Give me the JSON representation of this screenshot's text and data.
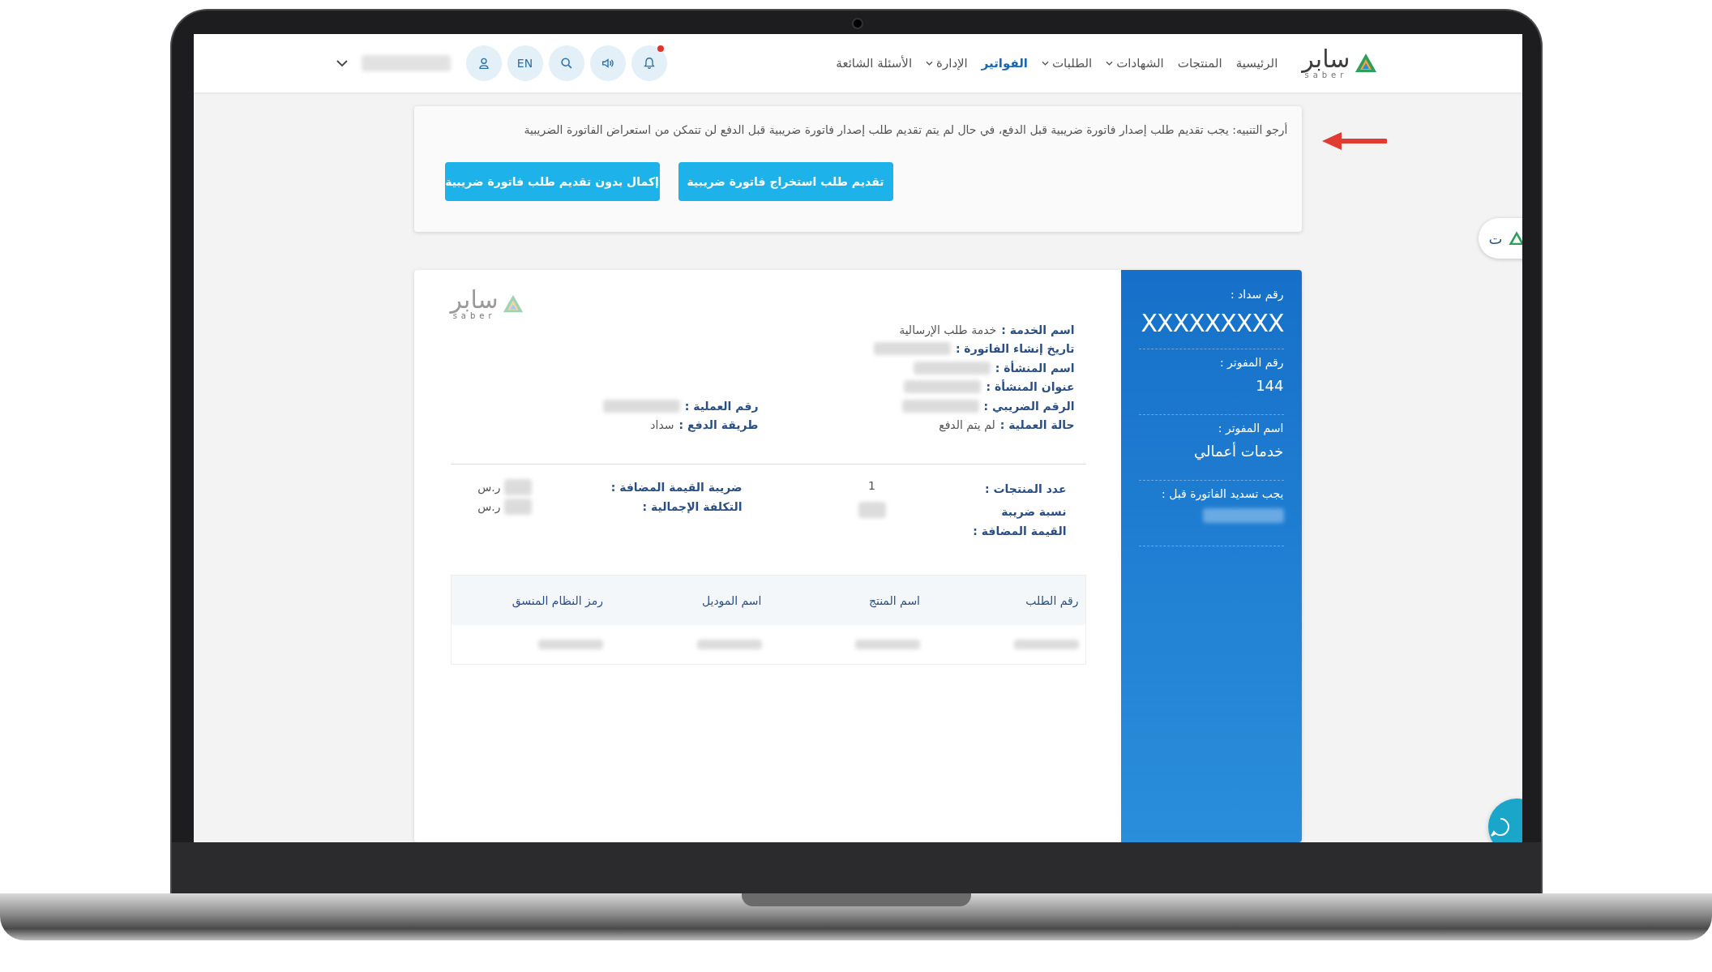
{
  "logo": {
    "arabic": "سابر",
    "latin": "saber"
  },
  "nav": {
    "items": [
      {
        "label": "الرئيسية",
        "dropdown": false,
        "selected": false
      },
      {
        "label": "المنتجات",
        "dropdown": false,
        "selected": false
      },
      {
        "label": "الشهادات",
        "dropdown": true,
        "selected": false
      },
      {
        "label": "الطلبات",
        "dropdown": true,
        "selected": false
      },
      {
        "label": "الفواتير",
        "dropdown": false,
        "selected": true
      },
      {
        "label": "الإدارة",
        "dropdown": true,
        "selected": false
      },
      {
        "label": "الأسئلة الشائعة",
        "dropdown": false,
        "selected": false
      }
    ]
  },
  "toolbar": {
    "bell_alert": true,
    "language": "EN"
  },
  "notice": {
    "text": "أرجو التنبيه: يجب تقديم طلب إصدار فاتورة ضريبية قبل الدفع، في حال لم يتم تقديم طلب إصدار فاتورة ضريبية قبل الدفع لن تتمكن من استعراض الفاتورة الضريبية",
    "buttons": [
      "تقديم طلب استخراج فاتورة ضريبية",
      "إكمال بدون تقديم طلب فاتورة ضريبية"
    ]
  },
  "invoice": {
    "details": [
      {
        "label": "اسم الخدمة :",
        "value": "خدمة طلب الإرسالية",
        "redacted": false
      },
      {
        "label": "تاريخ إنشاء الفاتورة :",
        "redacted": true
      },
      {
        "label": "اسم المنشأة :",
        "redacted": true
      },
      {
        "label": "عنوان المنشأة :",
        "redacted": true
      },
      {
        "label": "الرقم الضريبي :",
        "redacted": true
      },
      {
        "label": "حالة العملية :",
        "value": "لم يتم الدفع",
        "redacted": false
      }
    ],
    "payment": [
      {
        "label": "رقم العملية :",
        "redacted": true
      },
      {
        "label": "طريقة الدفع :",
        "value": "سداد",
        "redacted": false
      }
    ],
    "summary_right": [
      {
        "label": "عدد المنتجات :",
        "value": "1",
        "redacted": false
      },
      {
        "label": "نسبة ضريبة القيمة المضافة :",
        "redacted": true
      }
    ],
    "summary_left": [
      {
        "label": "ضريبة القيمة المضافة :",
        "redacted": true,
        "currency": "ر.س"
      },
      {
        "label": "التكلفة الإجمالية :",
        "redacted": true,
        "currency": "ر.س"
      }
    ],
    "table": {
      "columns": [
        "رقم الطلب",
        "اسم المنتج",
        "اسم الموديل",
        "رمز النظام المنسق"
      ],
      "rows": [
        {
          "cells": [
            {
              "redacted": true
            },
            {
              "redacted": true
            },
            {
              "redacted": true
            },
            {
              "redacted": true
            }
          ]
        }
      ]
    },
    "panel": [
      {
        "label": "رقم سداد :",
        "value": "XXXXXXXXX",
        "kind": "large",
        "redacted": false
      },
      {
        "label": "رقم المفوتر :",
        "value": "144",
        "kind": "normal",
        "redacted": false
      },
      {
        "label": "اسم المفوتر :",
        "value": "خدمات أعمالي",
        "kind": "normal",
        "redacted": false
      },
      {
        "label": "يجب تسديد الفاتورة قبل :",
        "kind": "normal",
        "redacted": true
      }
    ]
  },
  "sheet_logo": {
    "arabic": "سابر",
    "latin": "saber"
  },
  "side_tab": {
    "text": "ت"
  }
}
